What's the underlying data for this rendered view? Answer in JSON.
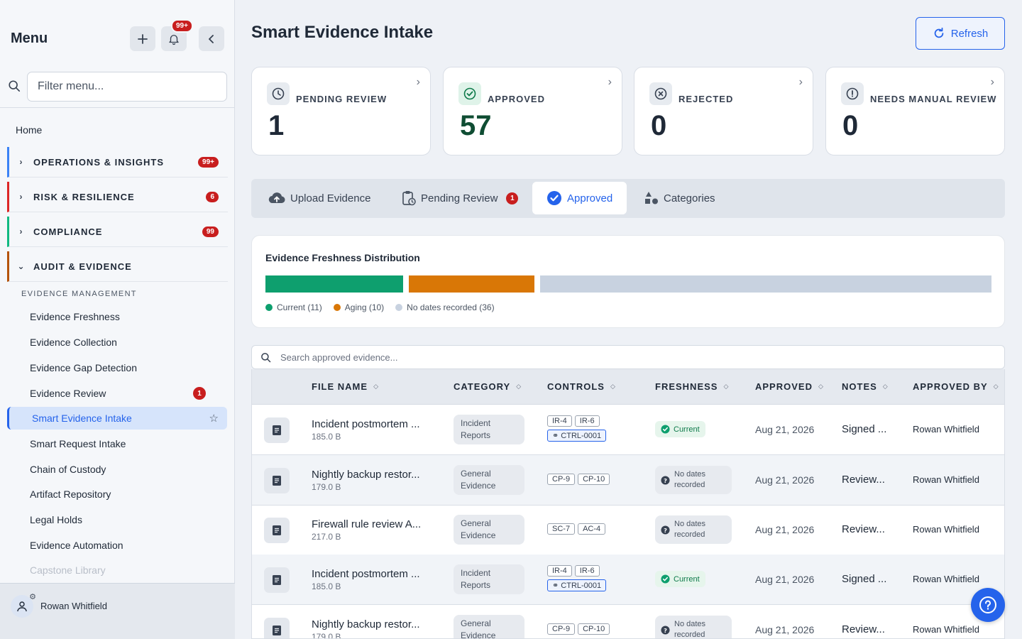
{
  "sidebar": {
    "title": "Menu",
    "notifications_badge": "99+",
    "filter_placeholder": "Filter menu...",
    "home_label": "Home",
    "sections": [
      {
        "label": "OPERATIONS & INSIGHTS",
        "badge": "99+",
        "color": "#3b82f6",
        "chevron": "›"
      },
      {
        "label": "RISK & RESILIENCE",
        "badge": "6",
        "color": "#dc2626",
        "chevron": "›"
      },
      {
        "label": "COMPLIANCE",
        "badge": "99",
        "color": "#10b981",
        "chevron": "›"
      },
      {
        "label": "AUDIT & EVIDENCE",
        "badge": "",
        "color": "#b45309",
        "chevron": "⌄"
      }
    ],
    "group_label": "EVIDENCE MANAGEMENT",
    "items": [
      {
        "label": "Evidence Freshness"
      },
      {
        "label": "Evidence Collection"
      },
      {
        "label": "Evidence Gap Detection"
      },
      {
        "label": "Evidence Review",
        "badge": "1"
      },
      {
        "label": "Smart Evidence Intake",
        "active": true
      },
      {
        "label": "Smart Request Intake"
      },
      {
        "label": "Chain of Custody"
      },
      {
        "label": "Artifact Repository"
      },
      {
        "label": "Legal Holds"
      },
      {
        "label": "Evidence Automation"
      },
      {
        "label": "Capstone Library"
      }
    ],
    "user_name": "Rowan Whitfield"
  },
  "header": {
    "title": "Smart Evidence Intake",
    "refresh_label": "Refresh"
  },
  "stats": [
    {
      "label": "PENDING REVIEW",
      "value": "1",
      "icon": "clock-icon"
    },
    {
      "label": "APPROVED",
      "value": "57",
      "icon": "check-circle-icon"
    },
    {
      "label": "REJECTED",
      "value": "0",
      "icon": "x-circle-icon"
    },
    {
      "label": "NEEDS MANUAL REVIEW",
      "value": "0",
      "icon": "alert-circle-icon"
    }
  ],
  "tabs": [
    {
      "label": "Upload Evidence",
      "icon": "cloud-upload-icon"
    },
    {
      "label": "Pending Review",
      "icon": "clipboard-clock-icon",
      "badge": "1"
    },
    {
      "label": "Approved",
      "icon": "check-badge-icon",
      "active": true
    },
    {
      "label": "Categories",
      "icon": "shapes-icon"
    }
  ],
  "freshness": {
    "title": "Evidence Freshness Distribution",
    "segments": [
      {
        "label": "Current (11)",
        "count": 11,
        "color": "#0e9f6e"
      },
      {
        "label": "Aging (10)",
        "count": 10,
        "color": "#d97706"
      },
      {
        "label": "No dates recorded (36)",
        "count": 36,
        "color": "#c8d2e0"
      }
    ]
  },
  "search": {
    "placeholder": "Search approved evidence..."
  },
  "table": {
    "columns": [
      "FILE NAME",
      "CATEGORY",
      "CONTROLS",
      "FRESHNESS",
      "APPROVED",
      "NOTES",
      "APPROVED BY"
    ],
    "rows": [
      {
        "file": "Incident postmortem ...",
        "size": "185.0 B",
        "cat1": "Incident",
        "cat2": "Reports",
        "controls": [
          "IR-4",
          "IR-6"
        ],
        "link": "CTRL-0001",
        "fresh": "Current",
        "fresh2": "",
        "approved": "Aug 21, 2026",
        "notes": "Signed ...",
        "by": "Rowan Whitfield"
      },
      {
        "file": "Nightly backup restor...",
        "size": "179.0 B",
        "cat1": "General",
        "cat2": "Evidence",
        "controls": [
          "CP-9",
          "CP-10"
        ],
        "link": "",
        "fresh": "No dates",
        "fresh2": "recorded",
        "approved": "Aug 21, 2026",
        "notes": "Review...",
        "by": "Rowan Whitfield"
      },
      {
        "file": "Firewall rule review A...",
        "size": "217.0 B",
        "cat1": "General",
        "cat2": "Evidence",
        "controls": [
          "SC-7",
          "AC-4"
        ],
        "link": "",
        "fresh": "No dates",
        "fresh2": "recorded",
        "approved": "Aug 21, 2026",
        "notes": "Review...",
        "by": "Rowan Whitfield"
      },
      {
        "file": "Incident postmortem ...",
        "size": "185.0 B",
        "cat1": "Incident",
        "cat2": "Reports",
        "controls": [
          "IR-4",
          "IR-6"
        ],
        "link": "CTRL-0001",
        "fresh": "Current",
        "fresh2": "",
        "approved": "Aug 21, 2026",
        "notes": "Signed ...",
        "by": "Rowan Whitfield"
      },
      {
        "file": "Nightly backup restor...",
        "size": "179.0 B",
        "cat1": "General",
        "cat2": "Evidence",
        "controls": [
          "CP-9",
          "CP-10"
        ],
        "link": "",
        "fresh": "No dates",
        "fresh2": "recorded",
        "approved": "Aug 21, 2026",
        "notes": "Review...",
        "by": "Rowan Whitfield"
      }
    ]
  },
  "help_icon": "help-icon"
}
